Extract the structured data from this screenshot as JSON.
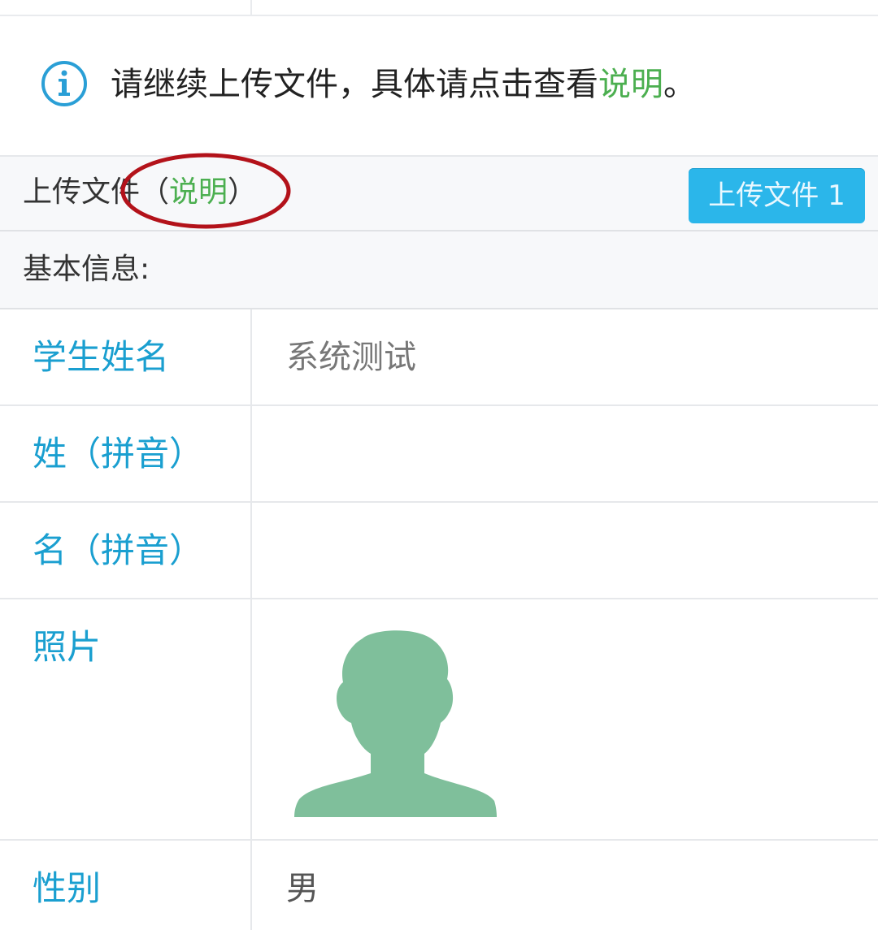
{
  "notice": {
    "icon": "info-icon",
    "text_prefix": "请继续上传文件，具体请点击查看",
    "link": "说明",
    "text_suffix": "。",
    "link_color": "#4caf50"
  },
  "upload": {
    "label": "上传文件",
    "paren_open": "（",
    "link": "说明",
    "paren_close": "）",
    "button_label": "上传文件 1",
    "button_color": "#2bb6ea",
    "annotation_color": "#b3121a"
  },
  "section": {
    "label": "基本信息:"
  },
  "form": {
    "label_color": "#1a9fd0",
    "rows": [
      {
        "label": "学生姓名",
        "value": "系统测试"
      },
      {
        "label": "姓（拼音）",
        "value": ""
      },
      {
        "label": "名（拼音）",
        "value": ""
      },
      {
        "label": "照片",
        "value": ""
      },
      {
        "label": "性别",
        "value": "男"
      }
    ],
    "avatar_icon": "person-silhouette-icon",
    "avatar_color": "#7fbf9b"
  }
}
